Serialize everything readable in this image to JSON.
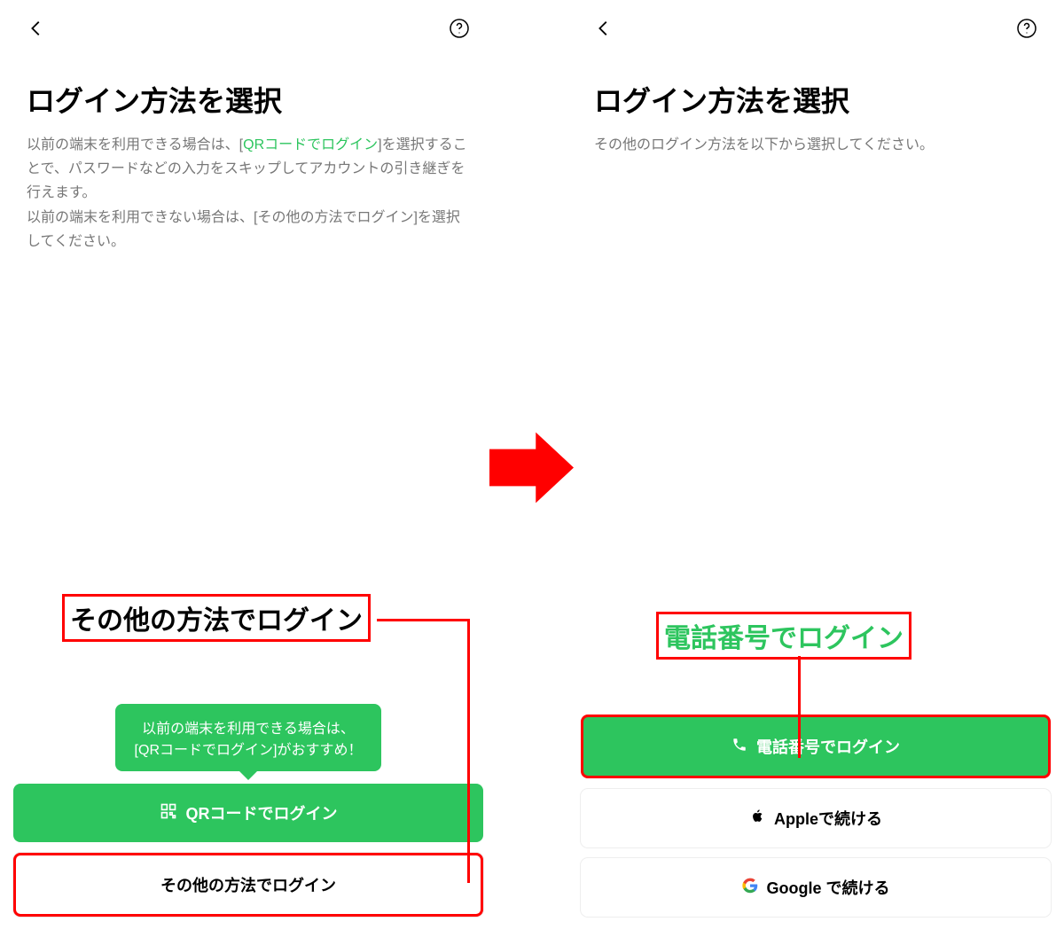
{
  "left": {
    "title": "ログイン方法を選択",
    "desc_prefix": "以前の端末を利用できる場合は、[",
    "desc_link": "QRコードでログイン",
    "desc_suffix": "]を選択することで、パスワードなどの入力をスキップしてアカウントの引き継ぎを行えます。\n以前の端末を利用できない場合は、[その他の方法でログイン]を選択してください。",
    "annotation": "その他の方法でログイン",
    "tooltip_line1": "以前の端末を利用できる場合は、",
    "tooltip_line2": "[QRコードでログイン]がおすすめ！",
    "qr_button": "QRコードでログイン",
    "other_button": "その他の方法でログイン"
  },
  "right": {
    "title": "ログイン方法を選択",
    "description": "その他のログイン方法を以下から選択してください。",
    "annotation": "電話番号でログイン",
    "phone_button": "電話番号でログイン",
    "apple_button": "Appleで続ける",
    "google_button": "Google で続ける"
  },
  "colors": {
    "accent_green": "#2dc55e",
    "annotation_red": "#ff0000"
  }
}
